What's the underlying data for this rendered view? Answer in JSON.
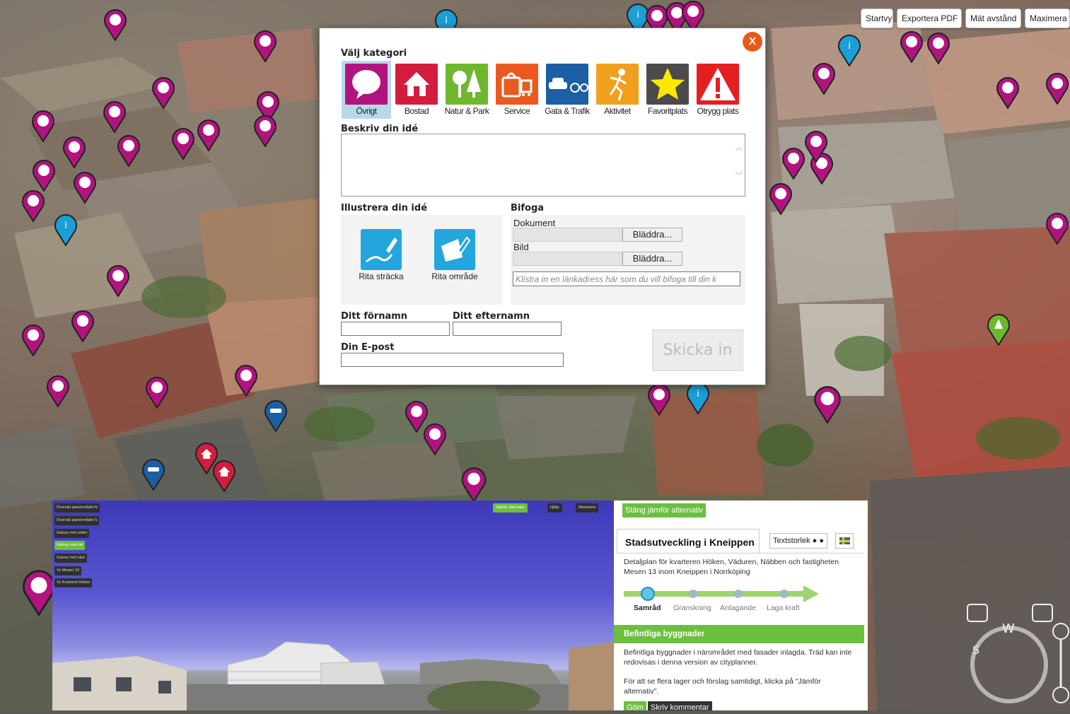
{
  "toolbar": {
    "startvy": "Startvy",
    "exportera_pdf": "Exportera PDF",
    "mat_avstand": "Mät avstånd",
    "maximera": "Maximera"
  },
  "dialog": {
    "close_label": "X",
    "category_heading": "Välj kategori",
    "categories": [
      {
        "label": "Övrigt",
        "color": "#b1147f",
        "icon": "speech-bubble-icon"
      },
      {
        "label": "Bostad",
        "color": "#d21d3f",
        "icon": "house-icon"
      },
      {
        "label": "Natur & Park",
        "color": "#6fb72d",
        "icon": "trees-icon"
      },
      {
        "label": "Service",
        "color": "#ea5a1f",
        "icon": "shopping-bag-icon"
      },
      {
        "label": "Gata & Trafik",
        "color": "#1c5fa4",
        "icon": "car-bike-icon"
      },
      {
        "label": "Aktivitet",
        "color": "#f0a01c",
        "icon": "running-person-icon"
      },
      {
        "label": "Favoritplats",
        "color": "#4b4b4b",
        "icon": "star-icon"
      },
      {
        "label": "Otrygg plats",
        "color": "#e41f1f",
        "icon": "warning-icon"
      }
    ],
    "describe_label": "Beskriv din idé",
    "illustrate_label": "Illustrera din idé",
    "draw_line_label": "Rita sträcka",
    "draw_area_label": "Rita område",
    "attach_label": "Bifoga",
    "document_label": "Dokument",
    "image_label": "Bild",
    "browse_label": "Bläddra...",
    "link_placeholder": "Klistra in en länkadress här som du vill bifoga till din k",
    "firstname_label": "Ditt förnamn",
    "lastname_label": "Ditt efternamn",
    "email_label": "Din E-post",
    "submit_label": "Skicka in"
  },
  "embed": {
    "view_buttons": [
      "Översikt planområdet N",
      "Översikt planområdet S",
      "Gatuvy mot söder",
      "Gatuvy mot öst",
      "Gatuvy mot väst",
      "Vy Mesen 13",
      "Vy Kvarteret Höken"
    ],
    "active_view_index": 3,
    "top_buttons": [
      "Jämför alternativ",
      "Hjälp",
      "Maximera"
    ],
    "close_compare": "Stäng jämför alternativ",
    "title": "Stadsutveckling i Kneippen",
    "text_size": "Textstorlek",
    "description": "Detaljplan för kvarteren Höken, Väduren, Näbben och fastigheten Mesen 13 inom Kneippen i Norrköping",
    "steps": [
      "Samråd",
      "Granskning",
      "Antagande",
      "Laga kraft"
    ],
    "active_step_index": 0,
    "section_title": "Befintliga byggnader",
    "section_text_1": "Befintliga byggnader i närområdet med fasader inlagda. Träd kan inte redovisas i denna version av cityplanner.",
    "section_text_2": "För att se flera lager och förslag samtidigt, klicka på \"Jämför alternativ\".",
    "hide_button": "Göm",
    "comment_button": "Skriv kommentar"
  },
  "colors": {
    "accent_green": "#6cbf3e",
    "close_orange": "#e85a1c",
    "selected_category_bg": "#b8d8ea",
    "pin_magenta": "#b1147f"
  }
}
